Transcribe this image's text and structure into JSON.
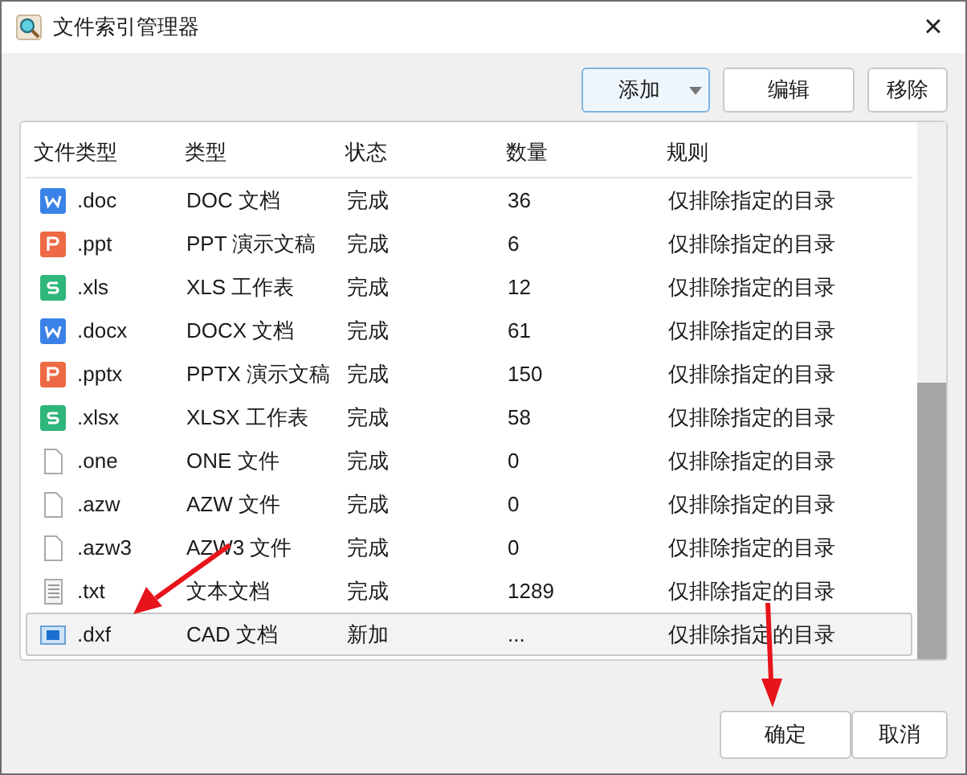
{
  "window": {
    "title": "文件索引管理器",
    "close": "×"
  },
  "toolbar": {
    "add": {
      "label": "添加",
      "selected": true
    },
    "edit": "编辑",
    "remove": "移除"
  },
  "table": {
    "columns": [
      "文件类型",
      "类型",
      "状态",
      "数量",
      "规则"
    ],
    "rows": [
      {
        "kind": "word",
        "ext": ".doc",
        "type": "DOC 文档",
        "status": "完成",
        "count": "36",
        "rule": "仅排除指定的目录",
        "selected": false
      },
      {
        "kind": "ppt",
        "ext": ".ppt",
        "type": "PPT 演示文稿",
        "status": "完成",
        "count": "6",
        "rule": "仅排除指定的目录",
        "selected": false
      },
      {
        "kind": "xls",
        "ext": ".xls",
        "type": "XLS 工作表",
        "status": "完成",
        "count": "12",
        "rule": "仅排除指定的目录",
        "selected": false
      },
      {
        "kind": "word",
        "ext": ".docx",
        "type": "DOCX 文档",
        "status": "完成",
        "count": "61",
        "rule": "仅排除指定的目录",
        "selected": false
      },
      {
        "kind": "ppt",
        "ext": ".pptx",
        "type": "PPTX 演示文稿",
        "status": "完成",
        "count": "150",
        "rule": "仅排除指定的目录",
        "selected": false
      },
      {
        "kind": "xls",
        "ext": ".xlsx",
        "type": "XLSX 工作表",
        "status": "完成",
        "count": "58",
        "rule": "仅排除指定的目录",
        "selected": false
      },
      {
        "kind": "blank",
        "ext": ".one",
        "type": "ONE 文件",
        "status": "完成",
        "count": "0",
        "rule": "仅排除指定的目录",
        "selected": false
      },
      {
        "kind": "blank",
        "ext": ".azw",
        "type": "AZW 文件",
        "status": "完成",
        "count": "0",
        "rule": "仅排除指定的目录",
        "selected": false
      },
      {
        "kind": "blank",
        "ext": ".azw3",
        "type": "AZW3 文件",
        "status": "完成",
        "count": "0",
        "rule": "仅排除指定的目录",
        "selected": false
      },
      {
        "kind": "text",
        "ext": ".txt",
        "type": "文本文档",
        "status": "完成",
        "count": "1289",
        "rule": "仅排除指定的目录",
        "selected": false
      },
      {
        "kind": "cad",
        "ext": ".dxf",
        "type": "CAD 文档",
        "status": "新加",
        "count": "...",
        "rule": "仅排除指定的目录",
        "selected": true
      }
    ]
  },
  "buttons": [
    "确定",
    "取消"
  ]
}
